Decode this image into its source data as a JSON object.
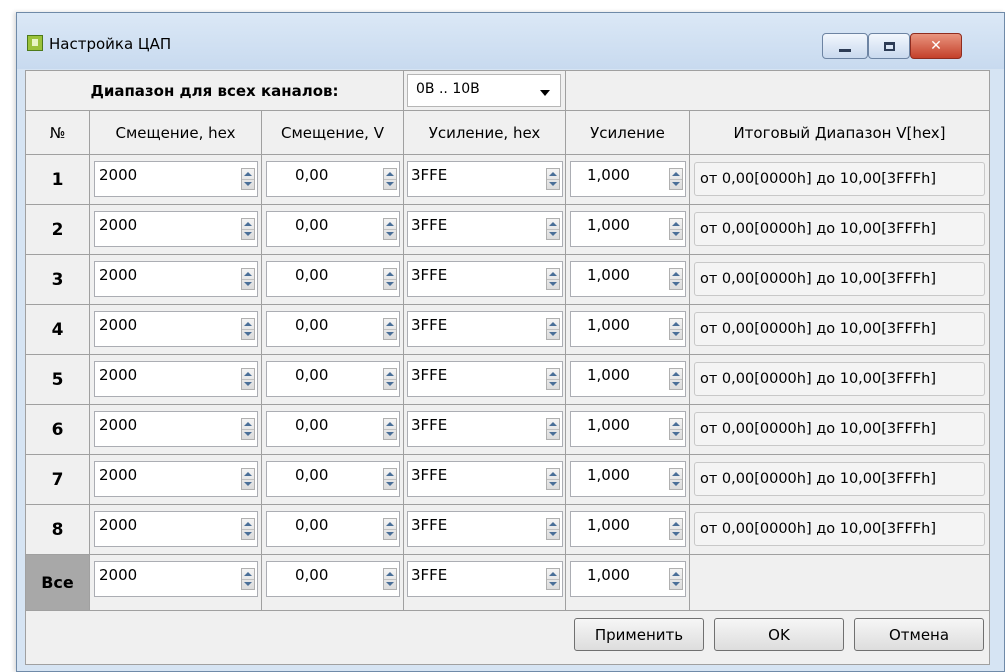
{
  "window": {
    "title": "Настройка ЦАП"
  },
  "range": {
    "label": "Диапазон для всех каналов:",
    "value": "0В .. 10В"
  },
  "columns": {
    "num": "№",
    "offset_hex": "Смещение, hex",
    "offset_v": "Смещение, V",
    "gain_hex": "Усиление, hex",
    "gain": "Усиление",
    "result": "Итоговый Диапазон V[hex]"
  },
  "rows": [
    {
      "num": "1",
      "offset_hex": "2000",
      "offset_v": "0,00",
      "gain_hex": "3FFE",
      "gain": "1,000",
      "result": "от 0,00[0000h] до 10,00[3FFFh]"
    },
    {
      "num": "2",
      "offset_hex": "2000",
      "offset_v": "0,00",
      "gain_hex": "3FFE",
      "gain": "1,000",
      "result": "от 0,00[0000h] до 10,00[3FFFh]"
    },
    {
      "num": "3",
      "offset_hex": "2000",
      "offset_v": "0,00",
      "gain_hex": "3FFE",
      "gain": "1,000",
      "result": "от 0,00[0000h] до 10,00[3FFFh]"
    },
    {
      "num": "4",
      "offset_hex": "2000",
      "offset_v": "0,00",
      "gain_hex": "3FFE",
      "gain": "1,000",
      "result": "от 0,00[0000h] до 10,00[3FFFh]"
    },
    {
      "num": "5",
      "offset_hex": "2000",
      "offset_v": "0,00",
      "gain_hex": "3FFE",
      "gain": "1,000",
      "result": "от 0,00[0000h] до 10,00[3FFFh]"
    },
    {
      "num": "6",
      "offset_hex": "2000",
      "offset_v": "0,00",
      "gain_hex": "3FFE",
      "gain": "1,000",
      "result": "от 0,00[0000h] до 10,00[3FFFh]"
    },
    {
      "num": "7",
      "offset_hex": "2000",
      "offset_v": "0,00",
      "gain_hex": "3FFE",
      "gain": "1,000",
      "result": "от 0,00[0000h] до 10,00[3FFFh]"
    },
    {
      "num": "8",
      "offset_hex": "2000",
      "offset_v": "0,00",
      "gain_hex": "3FFE",
      "gain": "1,000",
      "result": "от 0,00[0000h] до 10,00[3FFFh]"
    }
  ],
  "all_row": {
    "num": "Все",
    "offset_hex": "2000",
    "offset_v": "0,00",
    "gain_hex": "3FFE",
    "gain": "1,000"
  },
  "buttons": {
    "apply": "Применить",
    "ok": "OK",
    "cancel": "Отмена"
  },
  "icons": {
    "app": "dac-board-icon",
    "minimize": "minimize-icon",
    "maximize": "maximize-icon",
    "close": "close-icon",
    "combo_arrow": "chevron-down-icon",
    "spinner": "spin-updown-icon"
  },
  "colors": {
    "close_button": "#c4402a",
    "all_row_header": "#a8a8a8",
    "window_frame": "#c8daef"
  }
}
